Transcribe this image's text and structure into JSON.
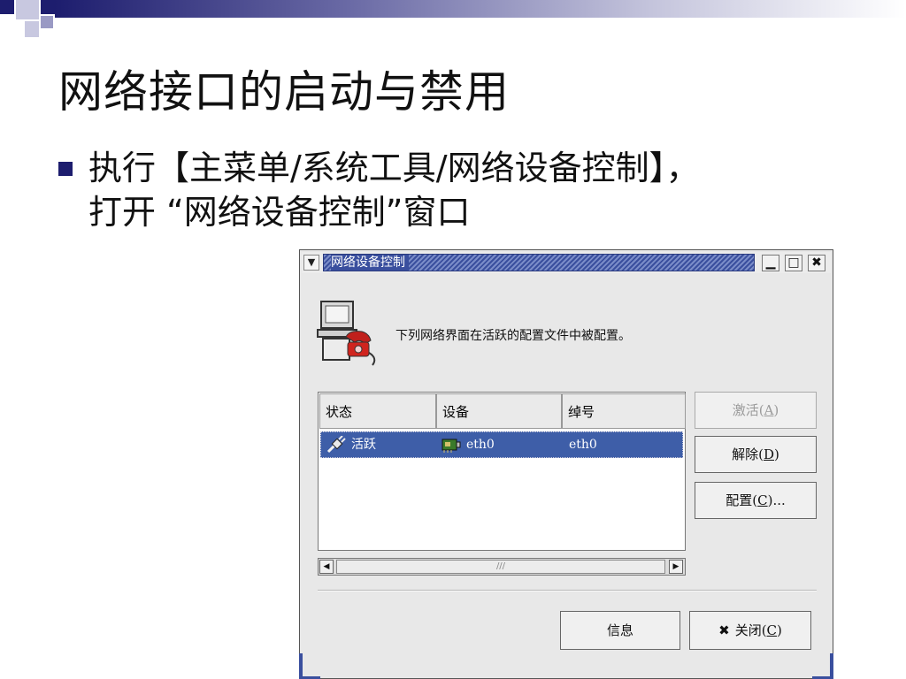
{
  "slide": {
    "title": "网络接口的启动与禁用",
    "bullet_line1": "执行【主菜单/系统工具/网络设备控制】，",
    "bullet_line2": "打开 “网络设备控制”窗口"
  },
  "dialog": {
    "title": "网络设备控制",
    "message": "下列网络界面在活跃的配置文件中被配置。",
    "columns": [
      "状态",
      "设备",
      "绰号"
    ],
    "rows": [
      {
        "status": "活跃",
        "device": "eth0",
        "nickname": "eth0"
      }
    ],
    "buttons": {
      "activate": {
        "text": "激活(",
        "key": "A",
        "close": ")"
      },
      "deactivate": {
        "text": "解除(",
        "key": "D",
        "close": ")"
      },
      "configure": {
        "text": "配置(",
        "key": "C",
        "close": ")..."
      },
      "info": "信息",
      "close": {
        "text": "关闭(",
        "key": "C",
        "close": ")"
      }
    },
    "scroll_thumb_text": "///",
    "window_buttons": {
      "minimize": "▁",
      "maximize": "□",
      "close": "✖"
    }
  },
  "colors": {
    "slide_accent": "#1d1d6e",
    "title_bar": "#3a4f9e",
    "selection": "#3e5ea8"
  },
  "icons": [
    "menu-chevron-icon",
    "minimize-icon",
    "maximize-icon",
    "close-icon",
    "computer-phone-icon",
    "plug-icon",
    "network-card-icon",
    "arrow-left-icon",
    "arrow-right-icon"
  ]
}
